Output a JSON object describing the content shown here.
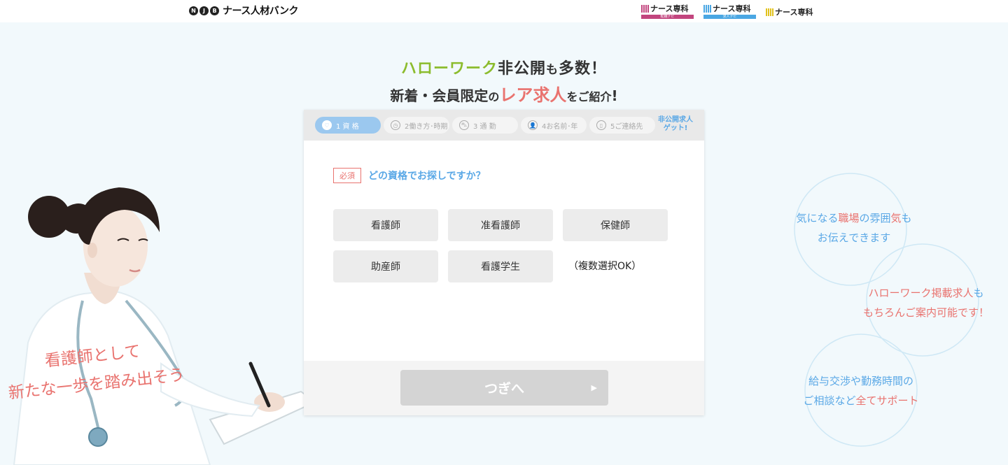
{
  "header": {
    "logo_mark": [
      "N",
      "J",
      "B"
    ],
    "logo_text": "ナース人材バンク",
    "partners": [
      {
        "name": "ナース専科",
        "sub": "転職ナビ",
        "color": "#c2457e"
      },
      {
        "name": "ナース専科",
        "sub": "求人ナビ",
        "color": "#4aa7e3"
      },
      {
        "name": "ナース専科",
        "color": "#e1c21e"
      }
    ]
  },
  "headline": {
    "line1_green": "ハローワーク",
    "line1_dark": "非公開",
    "line1_small1": "も",
    "line1_dark2": "多数",
    "line1_end": "！",
    "line2_start": "新着・会員限定",
    "line2_small1": "の",
    "line2_red": "レア求人",
    "line2_small2": "をご紹介",
    "line2_end": "!"
  },
  "steps": {
    "items": [
      {
        "icon": "♡",
        "label": "1 資 格"
      },
      {
        "icon": "◷",
        "label": "2働き方･時期"
      },
      {
        "icon": "⛍",
        "label": "3 通 勤"
      },
      {
        "icon": "👤",
        "label": "4お名前･年"
      },
      {
        "icon": "▯",
        "label": "5ご連絡先"
      }
    ],
    "reward_line1": "非公開求人",
    "reward_line2": "ゲット!"
  },
  "question": {
    "required_label": "必須",
    "text": "どの資格でお探しですか？"
  },
  "options": [
    "看護師",
    "准看護師",
    "保健師",
    "助産師",
    "看護学生"
  ],
  "multi_note": "（複数選択OK）",
  "next_button": {
    "label": "つぎへ",
    "arrow": "▶"
  },
  "nurse_copy": {
    "line1": "看護師として",
    "line2": "新たな一歩を踏み出そう"
  },
  "bubbles": [
    {
      "line1_blue1": "気になる",
      "line1_pink": "職場",
      "line1_blue2": "の雰囲",
      "line1_pink2": "気",
      "line1_blue3": "も",
      "line2": "お伝えできます"
    },
    {
      "line1_pink": "ハローワーク掲載求人",
      "line1_blue": "も",
      "line2": "もちろんご案内可能です！"
    },
    {
      "line1": "給与交渉や勤務時間の",
      "line2_blue": "ご相談など",
      "line2_pink": "全てサポート"
    }
  ],
  "colors": {
    "accent_blue": "#5aa8e6",
    "accent_pink": "#e9736f",
    "accent_green": "#8cbc2d",
    "background": "#f2f9fc"
  }
}
